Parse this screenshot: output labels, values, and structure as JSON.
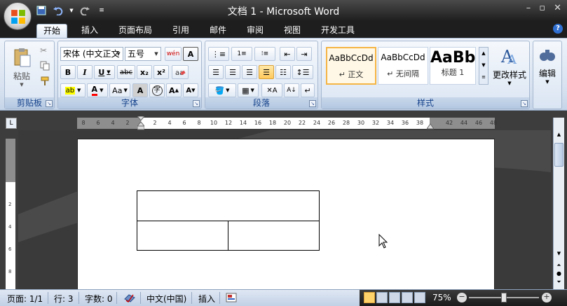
{
  "window": {
    "title": "文档 1 - Microsoft Word",
    "controls": [
      "–",
      "▫",
      "✕"
    ],
    "icons": {
      "office_button": "office-logo",
      "save": "save-icon",
      "undo": "undo-icon",
      "redo": "redo-icon",
      "customize": "qat-dropdown-icon"
    }
  },
  "tabs": [
    {
      "label": "开始",
      "active": true
    },
    {
      "label": "插入"
    },
    {
      "label": "页面布局"
    },
    {
      "label": "引用"
    },
    {
      "label": "邮件"
    },
    {
      "label": "审阅"
    },
    {
      "label": "视图"
    },
    {
      "label": "开发工具"
    }
  ],
  "ribbon": {
    "clipboard": {
      "label": "剪贴板",
      "paste": "粘贴"
    },
    "font": {
      "label": "字体",
      "font_name": "宋体 (中文正文",
      "font_size": "五号",
      "wen": "wén",
      "wen2": "文",
      "bold": "B",
      "italic": "I",
      "underline": "U",
      "strike": "abc",
      "subscript": "x₂",
      "superscript": "x²",
      "clear": "A",
      "highlight": "ab",
      "font_color": "A",
      "change_case": "Aa",
      "char_shade": "A",
      "enclose": "字",
      "grow": "A",
      "shrink": "A"
    },
    "paragraph": {
      "label": "段落"
    },
    "styles": {
      "label": "样式",
      "items": [
        {
          "sample": "AaBbCcDd",
          "name": "↵ 正文",
          "selected": true
        },
        {
          "sample": "AaBbCcDd",
          "name": "↵ 无间隔"
        },
        {
          "sample": "AaBb",
          "name": "标题 1"
        }
      ],
      "change_styles": "更改样式"
    },
    "editing": {
      "label": "编辑"
    }
  },
  "ruler": {
    "left_ticks": [
      "8",
      "6",
      "4",
      "2"
    ],
    "ticks": [
      "2",
      "4",
      "6",
      "8",
      "10",
      "12",
      "14",
      "16",
      "18",
      "20",
      "22",
      "24",
      "26",
      "28",
      "30",
      "32",
      "34",
      "36",
      "38"
    ],
    "right_ticks": [
      "42",
      "44",
      "46",
      "48"
    ],
    "corner": "L"
  },
  "status": {
    "page": "页面: 1/1",
    "line": "行: 3",
    "words": "字数: 0",
    "language": "中文(中国)",
    "mode": "插入",
    "zoom": "75%",
    "zoom_level": 0.5
  },
  "colors": {
    "accent": "#2b579a",
    "highlight": "#ffff00",
    "font_color": "#ff0000",
    "ribbon_bg": "#d5e0ef"
  }
}
